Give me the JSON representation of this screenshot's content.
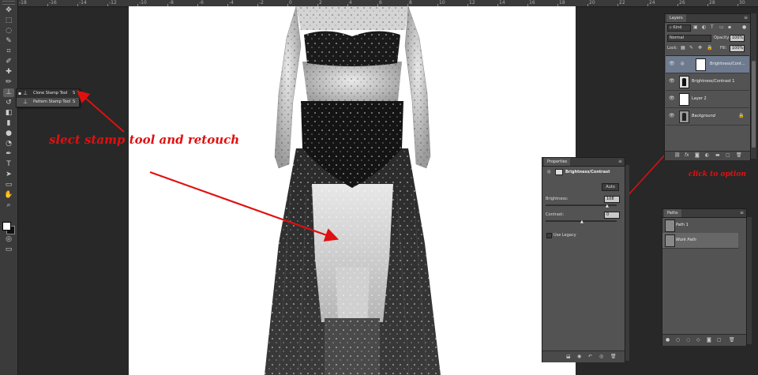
{
  "ruler": {
    "labels": [
      "-18",
      "-16",
      "-14",
      "-12",
      "-10",
      "-8",
      "-6",
      "-4",
      "-2",
      "0",
      "2",
      "4",
      "6",
      "8",
      "10",
      "12",
      "14",
      "16",
      "18",
      "20",
      "22",
      "24",
      "26",
      "28",
      "30"
    ]
  },
  "toolbar": {
    "tools": [
      "move-tool-icon",
      "marquee-tool-icon",
      "lasso-tool-icon",
      "quick-select-tool-icon",
      "crop-tool-icon",
      "eyedropper-tool-icon",
      "healing-brush-tool-icon",
      "brush-tool-icon",
      "clone-stamp-tool-icon",
      "history-brush-tool-icon",
      "eraser-tool-icon",
      "gradient-tool-icon",
      "blur-tool-icon",
      "dodge-tool-icon",
      "pen-tool-icon",
      "type-tool-icon",
      "path-select-tool-icon",
      "shape-tool-icon",
      "hand-tool-icon",
      "zoom-tool-icon"
    ],
    "glyphs": [
      "✥",
      "⬚",
      "◌",
      "✎",
      "⌗",
      "✐",
      "✚",
      "✏",
      "⊥",
      "↺",
      "◧",
      "▮",
      "●",
      "◔",
      "✒",
      "T",
      "➤",
      "▭",
      "✋",
      "⌕"
    ],
    "active_tool": "clone-stamp-tool-icon"
  },
  "flyout": {
    "items": [
      {
        "label": "Clone Stamp Tool",
        "key": "S",
        "active": true
      },
      {
        "label": "Pattern Stamp Tool",
        "key": "S",
        "active": false
      }
    ]
  },
  "annotations": {
    "stamp_note": "slect stamp tool and  retouch",
    "click_note": "click to option"
  },
  "layers_panel": {
    "tab": "Layers",
    "kind_filter": "Kind",
    "blend_mode": "Normal",
    "opacity_label": "Opacity:",
    "opacity_value": "100%",
    "lock_label": "Lock:",
    "fill_label": "Fill:",
    "fill_value": "100%",
    "layers": [
      {
        "name": "Brightness/Cont...",
        "selected": true,
        "type": "adjustment"
      },
      {
        "name": "Brightness/Contrast 1",
        "selected": false,
        "type": "adjustment"
      },
      {
        "name": "Layer 2",
        "selected": false,
        "type": "pixel"
      },
      {
        "name": "Background",
        "selected": false,
        "type": "background"
      }
    ],
    "footer_icons": [
      "link-icon",
      "fx-icon",
      "mask-icon",
      "adjustment-icon",
      "folder-icon",
      "new-layer-icon",
      "trash-icon"
    ],
    "footer_glyphs": [
      "⛓",
      "fx",
      "◙",
      "◐",
      "▬",
      "▢",
      "🗑"
    ]
  },
  "properties_panel": {
    "tab": "Properties",
    "title": "Brightness/Contrast",
    "auto_button": "Auto",
    "brightness_label": "Brightness:",
    "brightness_value": "108",
    "contrast_label": "Contrast:",
    "contrast_value": "0",
    "legacy_label": "Use Legacy",
    "footer_icons": [
      "clip-icon",
      "view-previous-icon",
      "reset-icon",
      "visibility-icon",
      "trash-icon"
    ],
    "footer_glyphs": [
      "⬓",
      "◉",
      "↶",
      "◎",
      "🗑"
    ]
  },
  "paths_panel": {
    "tab": "Paths",
    "paths": [
      {
        "name": "Path 1",
        "selected": false
      },
      {
        "name": "Work Path",
        "selected": true
      }
    ],
    "footer_icons": [
      "fill-path-icon",
      "stroke-path-icon",
      "load-selection-icon",
      "make-path-icon",
      "add-mask-icon",
      "new-path-icon",
      "trash-icon"
    ],
    "footer_glyphs": [
      "●",
      "○",
      "◌",
      "◇",
      "◙",
      "▢",
      "🗑"
    ]
  },
  "colors": {
    "annotation": "#e01010",
    "panel_bg": "#535353",
    "workspace": "#282828"
  }
}
